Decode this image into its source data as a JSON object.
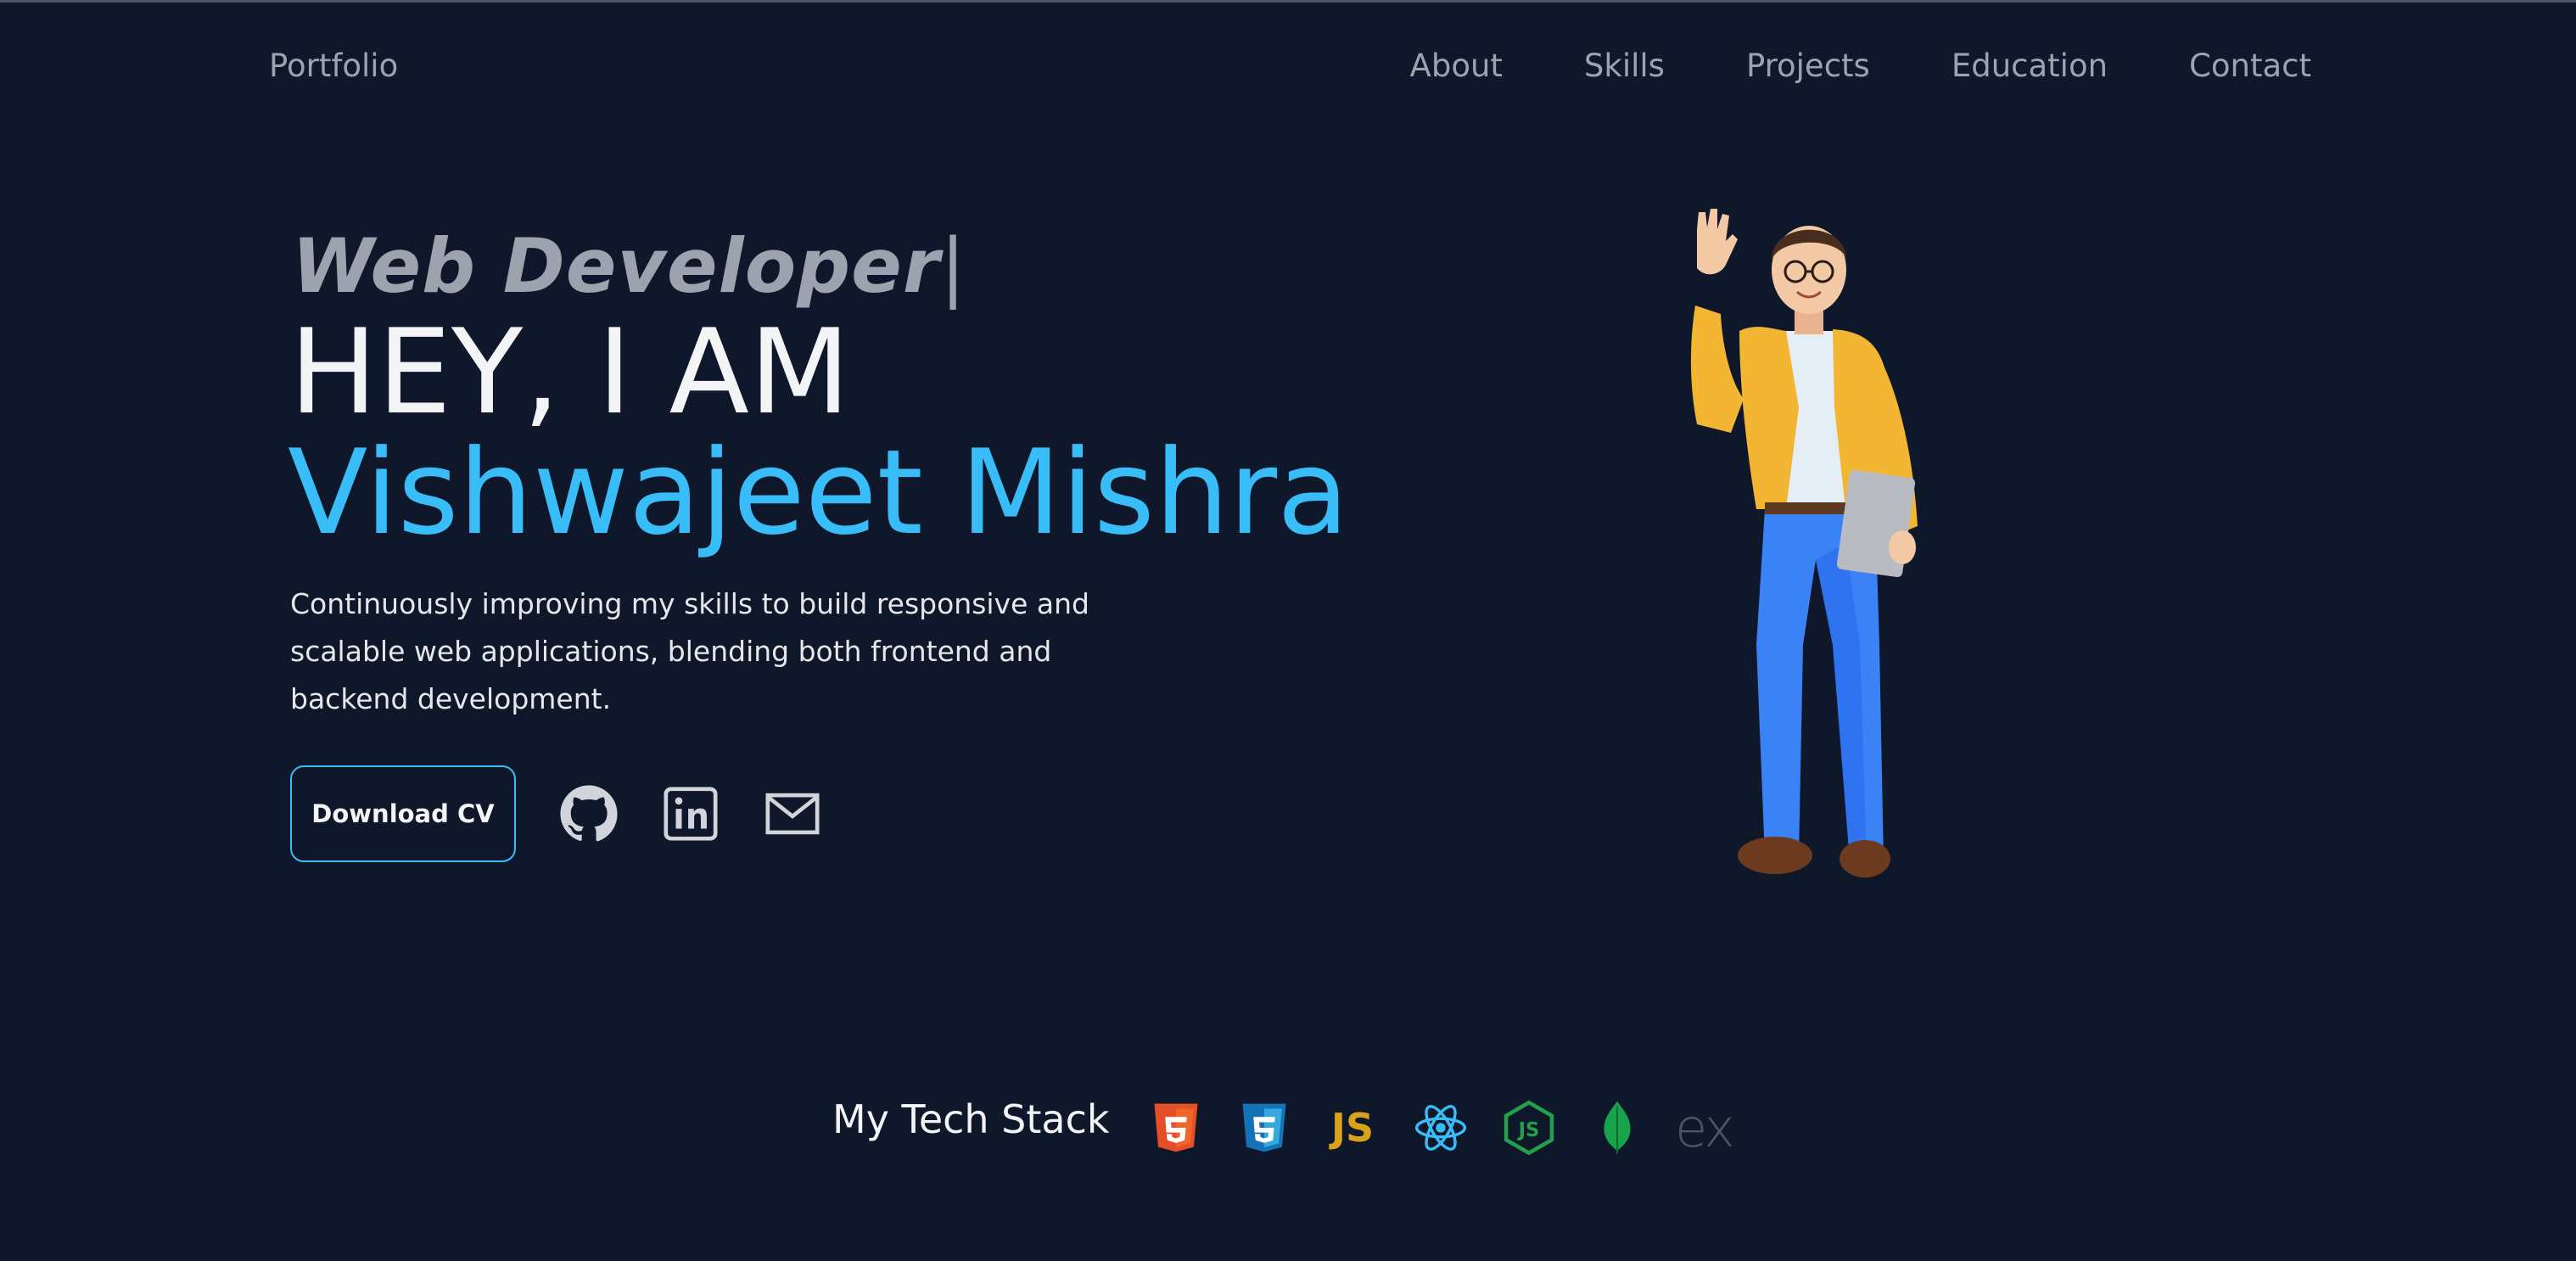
{
  "nav": {
    "logo": "Portfolio",
    "items": [
      "About",
      "Skills",
      "Projects",
      "Education",
      "Contact"
    ]
  },
  "hero": {
    "role": "Web Developer",
    "cursor": "|",
    "greeting": "HEY, I AM",
    "name": "Vishwajeet Mishra",
    "description_lines": [
      "Continuously improving my skills to build responsive and",
      "scalable web applications, blending both frontend and",
      "backend development."
    ],
    "cv_button": "Download CV",
    "social_icons": [
      "github-icon",
      "linkedin-icon",
      "mail-icon"
    ]
  },
  "illustration": {
    "subject": "3d-developer-avatar"
  },
  "tech_stack": {
    "title": "My Tech Stack",
    "icons": [
      "html5-icon",
      "css3-icon",
      "javascript-icon",
      "react-icon",
      "nodejs-icon",
      "mongodb-icon",
      "express-icon"
    ],
    "js_label": "JS",
    "express_label": "ex"
  },
  "colors": {
    "background": "#0f172a",
    "accent": "#38bdf8",
    "muted": "#9ca3af",
    "text": "#f3f4f6"
  }
}
